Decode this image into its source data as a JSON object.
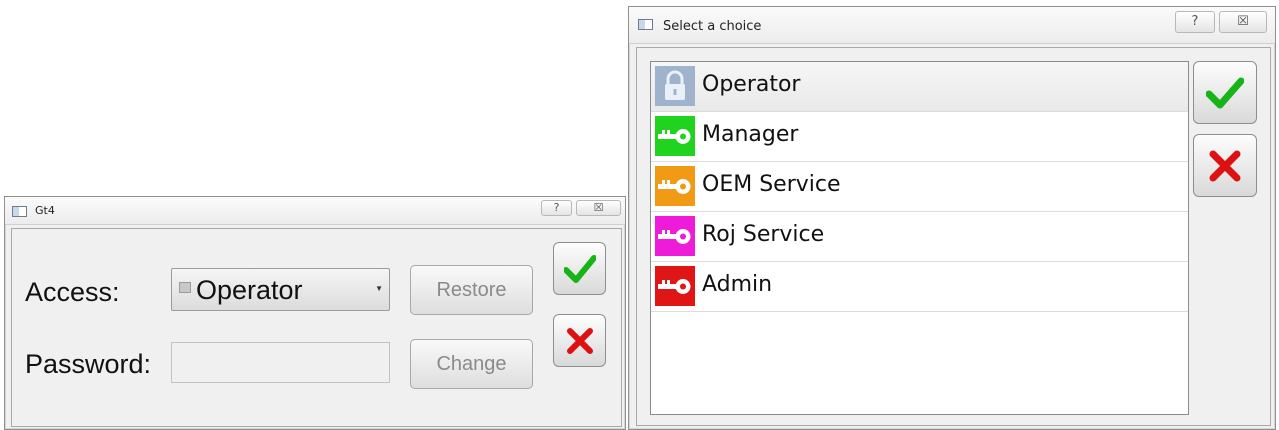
{
  "login_dialog": {
    "title": "Gt4",
    "help_glyph": "?",
    "close_glyph": "☒",
    "access_label": "Access:",
    "password_label": "Password:",
    "access_value": "Operator",
    "access_icon": "lock-icon",
    "password_value": "",
    "restore_label": "Restore",
    "change_label": "Change",
    "ok_icon": "checkmark-icon",
    "cancel_icon": "red-x-icon"
  },
  "choice_dialog": {
    "title": "Select a choice",
    "help_glyph": "?",
    "close_glyph": "☒",
    "items": [
      {
        "label": "Operator",
        "icon": "lock-icon",
        "color": "#9fb4cc",
        "selected": true
      },
      {
        "label": "Manager",
        "icon": "key-icon",
        "color": "#1fd31f",
        "selected": false
      },
      {
        "label": "OEM Service",
        "icon": "key-icon",
        "color": "#f09a16",
        "selected": false
      },
      {
        "label": "Roj Service",
        "icon": "key-icon",
        "color": "#ee1bd8",
        "selected": false
      },
      {
        "label": "Admin",
        "icon": "key-icon",
        "color": "#e01616",
        "selected": false
      }
    ],
    "ok_icon": "checkmark-icon",
    "cancel_icon": "red-x-icon"
  },
  "colors": {
    "check_green": "#17b317",
    "x_red": "#dd1111",
    "window_bg": "#f0f0f0"
  }
}
